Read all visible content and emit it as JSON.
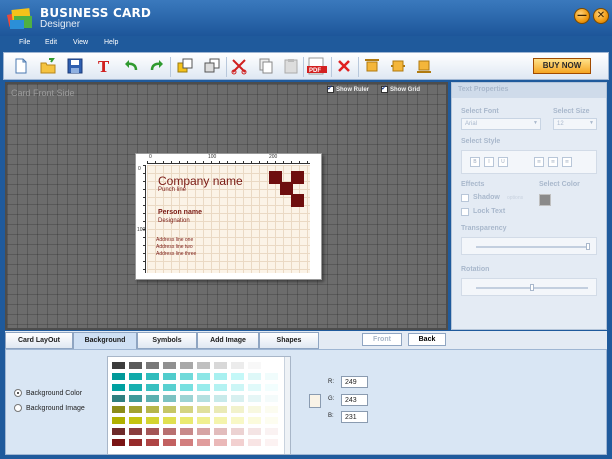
{
  "app": {
    "brand_line1": "BUSINESS CARD",
    "brand_line2": "Designer"
  },
  "window": {
    "minimize_label": "—",
    "close_label": "✕"
  },
  "menu": [
    "File",
    "Edit",
    "View",
    "Help"
  ],
  "toolbar": {
    "buttons": [
      "new-icon",
      "open-icon",
      "save-icon",
      "text-icon",
      "undo-icon",
      "redo-icon",
      "bring-front-icon",
      "send-back-icon",
      "cut-icon",
      "copy-icon",
      "paste-icon",
      "pdf-icon",
      "delete-icon",
      "align-top-icon",
      "align-middle-icon",
      "align-bottom-icon"
    ],
    "pdf_text": "PDF",
    "buy_now": "BUY NOW"
  },
  "canvas": {
    "side_label": "Card Front Side",
    "show_ruler": "Show Ruler",
    "show_grid": "Show Grid",
    "ruler_top": [
      "0",
      "100",
      "200"
    ],
    "ruler_left": [
      "0",
      "100"
    ],
    "card": {
      "company": "Company name",
      "punch": "Punch line",
      "person": "Person name",
      "designation": "Designation",
      "address": [
        "Address line one",
        "Address line two",
        "Address line three"
      ]
    }
  },
  "text_properties": {
    "title": "Text Properties",
    "select_font": "Select Font",
    "font_value": "Arial",
    "select_size": "Select Size",
    "size_value": "12",
    "select_style": "Select Style",
    "style_buttons": [
      "B",
      "I",
      "U"
    ],
    "effects": "Effects",
    "select_color": "Select Color",
    "shadow": "Shadow",
    "shadow_options": "options",
    "lock_text": "Lock Text",
    "transparency": "Transparency",
    "rotation": "Rotation",
    "transparency_level": 1.0,
    "rotation_level": 0.5
  },
  "tabs": [
    "Card LayOut",
    "Background",
    "Symbols",
    "Add Image",
    "Shapes"
  ],
  "active_tab": "Background",
  "side_buttons": {
    "front": "Front",
    "back": "Back"
  },
  "background": {
    "option_color": "Background Color",
    "option_image": "Background Image",
    "r_label": "R:",
    "g_label": "G:",
    "b_label": "B:",
    "r": "249",
    "g": "243",
    "b": "231",
    "preview_color": "#f9f3e7"
  },
  "colors": {
    "palette_rows": [
      [
        "#3c3c3c",
        "#5a5a5a",
        "#787878",
        "#909090",
        "#a8a8a8",
        "#c0c0c0",
        "#d8d8d8",
        "#ececec",
        "#f8f8f8",
        "#ffffff"
      ],
      [
        "#009999",
        "#10aaaa",
        "#30bcbc",
        "#50cccc",
        "#70dada",
        "#8ce6e6",
        "#a8f0f0",
        "#c4f8f8",
        "#def8f8",
        "#f0fcfc"
      ],
      [
        "#00a0a0",
        "#18b0b0",
        "#38c0c0",
        "#58d0d0",
        "#78e0e0",
        "#98ecec",
        "#b4f2f2",
        "#ccf6f6",
        "#e0fafa",
        "#f2fefe"
      ],
      [
        "#2f7f7f",
        "#3f9a9a",
        "#5cb0b0",
        "#7cc2c2",
        "#9cd4d4",
        "#b4e0e0",
        "#c8eaea",
        "#d8f0f0",
        "#e6f6f6",
        "#f4fbfb"
      ],
      [
        "#8c8c1a",
        "#a2a230",
        "#b6b64a",
        "#c6c666",
        "#d4d482",
        "#e0e09c",
        "#eaeab6",
        "#f2f2cc",
        "#f8f8e0",
        "#fcfcf0"
      ],
      [
        "#b0b000",
        "#c4c410",
        "#d4d430",
        "#e0e050",
        "#eaea70",
        "#f0f090",
        "#f4f4ac",
        "#f8f8c6",
        "#fbfbdc",
        "#fdfdf0"
      ],
      [
        "#6e2a2a",
        "#8a3e3e",
        "#a45656",
        "#b87070",
        "#c88a8a",
        "#d6a4a4",
        "#e2bcbc",
        "#ecd2d2",
        "#f4e4e4",
        "#faf2f2"
      ],
      [
        "#7a1414",
        "#962a2a",
        "#ae4444",
        "#c26060",
        "#d27e7e",
        "#e09c9c",
        "#eab8b8",
        "#f2d0d0",
        "#f8e4e4",
        "#fcf2f2"
      ]
    ],
    "accent": "#1f5a9c",
    "card_text": "#7a1a14",
    "card_image": "#6e0e0e"
  }
}
